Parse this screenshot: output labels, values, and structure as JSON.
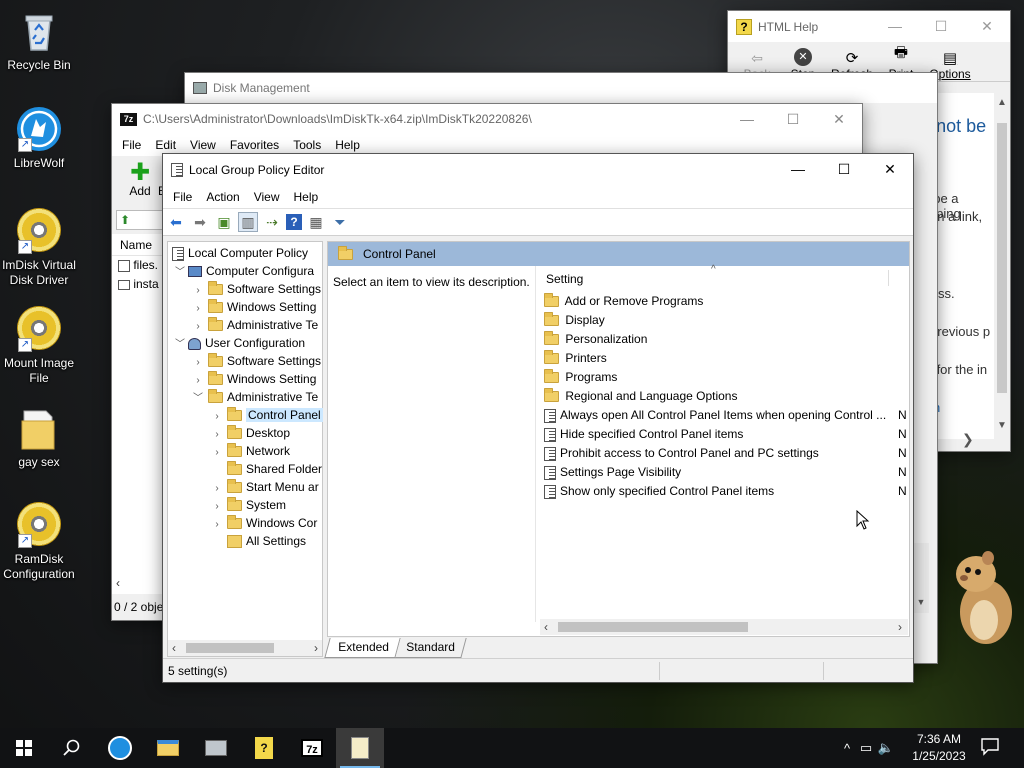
{
  "desktop": {
    "icons": [
      {
        "label": "Recycle Bin"
      },
      {
        "label": "LibreWolf"
      },
      {
        "label": "ImDisk Virtual Disk Driver"
      },
      {
        "label": "Mount Image File"
      },
      {
        "label": "gay sex"
      },
      {
        "label": "RamDisk Configuration"
      }
    ]
  },
  "html_help": {
    "title": "HTML Help",
    "toolbar": [
      "Back",
      "Stop",
      "Refresh",
      "Print",
      "Options"
    ],
    "content": {
      "heading": "bpage cannot be",
      "line1": "s:",
      "line2": "t be a typing",
      "line3": "ed on a link,",
      "line4": "ddress.",
      "line5": "he previous p",
      "line6": "ook for the in",
      "link": "ation"
    }
  },
  "disk_mgmt": {
    "title": "Disk Management"
  },
  "sevenzip": {
    "title": "C:\\Users\\Administrator\\Downloads\\ImDiskTk-x64.zip\\ImDiskTk20220826\\",
    "menu": [
      "File",
      "Edit",
      "View",
      "Favorites",
      "Tools",
      "Help"
    ],
    "toolbar_add": "Add",
    "toolbar_e": "E",
    "col_name": "Name",
    "files": [
      "files.",
      "insta"
    ],
    "status": "0 / 2 obje"
  },
  "gpedit": {
    "title": "Local Group Policy Editor",
    "menu": [
      "File",
      "Action",
      "View",
      "Help"
    ],
    "tree": [
      {
        "label": "Local Computer Policy"
      },
      {
        "label": "Computer Configura"
      },
      {
        "label": "Software Settings"
      },
      {
        "label": "Windows Setting"
      },
      {
        "label": "Administrative Te"
      },
      {
        "label": "User Configuration"
      },
      {
        "label": "Software Settings"
      },
      {
        "label": "Windows Setting"
      },
      {
        "label": "Administrative Te"
      },
      {
        "label": "Control Panel"
      },
      {
        "label": "Desktop"
      },
      {
        "label": "Network"
      },
      {
        "label": "Shared Folder"
      },
      {
        "label": "Start Menu ar"
      },
      {
        "label": "System"
      },
      {
        "label": "Windows Cor"
      },
      {
        "label": "All Settings"
      }
    ],
    "pane_title": "Control Panel",
    "description": "Select an item to view its description.",
    "col_setting": "Setting",
    "settings": [
      {
        "label": "Add or Remove Programs",
        "state": ""
      },
      {
        "label": "Display",
        "state": ""
      },
      {
        "label": "Personalization",
        "state": ""
      },
      {
        "label": "Printers",
        "state": ""
      },
      {
        "label": "Programs",
        "state": ""
      },
      {
        "label": "Regional and Language Options",
        "state": ""
      },
      {
        "label": "Always open All Control Panel Items when opening Control ...",
        "state": "N"
      },
      {
        "label": "Hide specified Control Panel items",
        "state": "N"
      },
      {
        "label": "Prohibit access to Control Panel and PC settings",
        "state": "N"
      },
      {
        "label": "Settings Page Visibility",
        "state": "N"
      },
      {
        "label": "Show only specified Control Panel items",
        "state": "N"
      }
    ],
    "tabs": [
      "Extended",
      "Standard"
    ],
    "status": "5 setting(s)"
  },
  "taskbar": {
    "time": "7:36 AM",
    "date": "1/25/2023"
  }
}
